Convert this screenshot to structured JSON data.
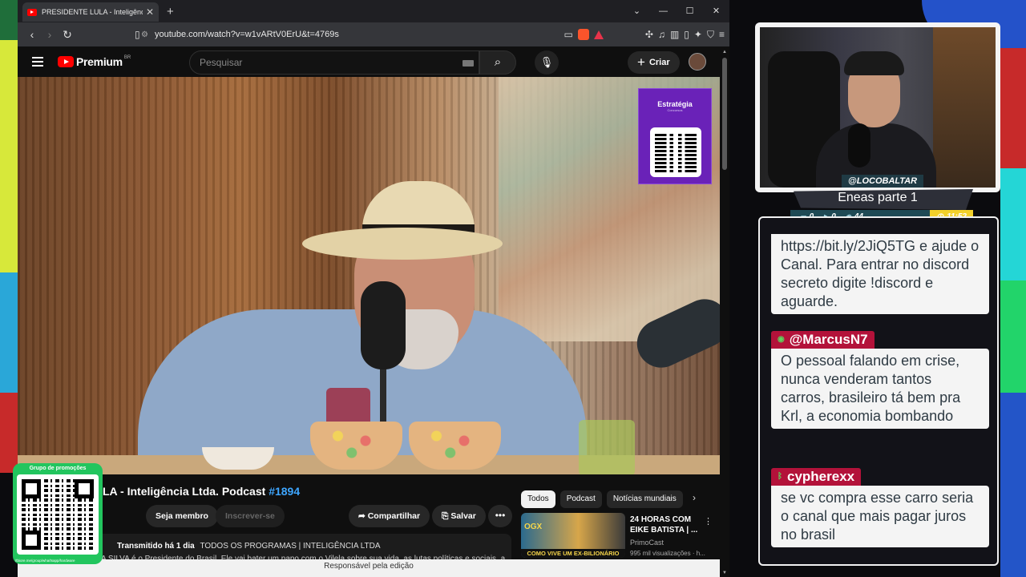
{
  "browser": {
    "tab_title": "PRESIDENTE LULA - Inteligência Ltda. P",
    "tab_close": "✕",
    "new_tab": "+",
    "window_controls": [
      "⌄",
      "—",
      "☐",
      "✕"
    ],
    "url": "youtube.com/watch?v=w1vARtV0ErU&t=4769s",
    "status_bar_text": "Responsável pela edição"
  },
  "youtube": {
    "brand": "Premium",
    "country": "BR",
    "search_placeholder": "Pesquisar",
    "create_label": "Criar",
    "create_plus": "+",
    "video_title_prefix": "LA - Inteligência Ltda. Podcast ",
    "video_title_tag": "#1894",
    "member_label": "Seja membro",
    "subscribe_label": "Inscrever-se",
    "share_label": "Compartilhar",
    "save_label": "Salvar",
    "more_label": "•••",
    "desc_meta": "Transmitido há 1 dia",
    "desc_programs": "TODOS OS PROGRAMAS | INTELIGÊNCIA LTDA",
    "desc_text": "A SILVA é o Presidente do Brasil. Ele vai bater um papo com o Vilela sobre sua vida, as lutas políticas e sociais, a",
    "chips": [
      "Todos",
      "Podcast",
      "Notícias mundiais"
    ],
    "chip_next": "›",
    "reco": {
      "badge": "OGX",
      "caption": "COMO VIVE UM EX-BILIONÁRIO",
      "title": "24 HORAS COM EIKE BATISTA | ...",
      "channel": "PrimoCast",
      "views": "995 mil visualizações · h...",
      "more": "⋮"
    }
  },
  "sponsor": {
    "brand": "Estratégia",
    "sub": "Concursos"
  },
  "overlay": {
    "promo_title": "Grupo de promoções",
    "promo_url": "/tbiore.me/group/wha/tsapp/hardware",
    "streamer": "@LOCOBALTAR",
    "stream_title": "Eneas parte 1",
    "stats": [
      {
        "icon": "chat-icon",
        "glyph": "▭",
        "value": "0"
      },
      {
        "icon": "youtube-icon",
        "glyph": "▶",
        "value": "0"
      },
      {
        "icon": "viewers-icon",
        "glyph": "◉",
        "value": "44"
      }
    ],
    "time": "11:52",
    "time_icon": "◷",
    "chat": [
      {
        "user": "",
        "text": "https://bit.ly/2JiQ5TG e ajude o Canal. Para entrar no discord secreto digite !discord e aguarde."
      },
      {
        "user": "@MarcusN7",
        "text": "O pessoal falando em crise, nunca venderam tantos carros, brasileiro tá bem pra Krl, a economia bombando"
      },
      {
        "user": "cypherexx",
        "text": "se vc compra esse carro seria o canal que mais pagar juros no brasil"
      }
    ]
  }
}
